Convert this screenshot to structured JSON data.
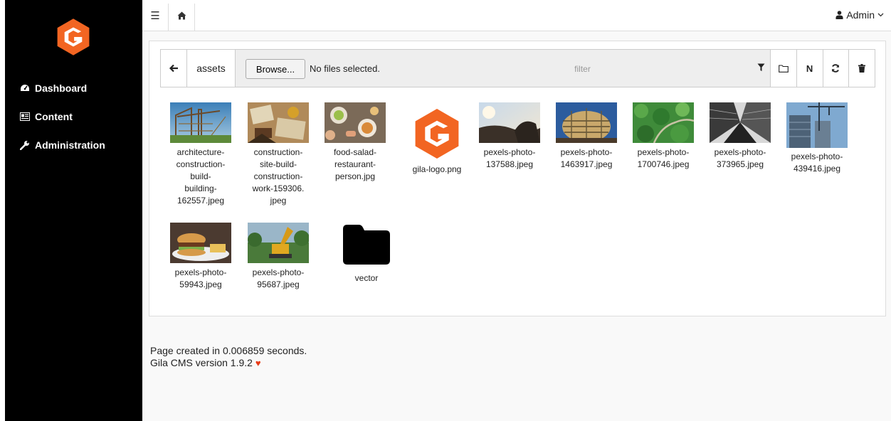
{
  "app": {
    "name": "Gila CMS"
  },
  "sidebar": {
    "items": [
      {
        "label": "Dashboard",
        "icon": "dashboard-icon"
      },
      {
        "label": "Content",
        "icon": "content-icon"
      },
      {
        "label": "Administration",
        "icon": "wrench-icon"
      }
    ]
  },
  "topbar": {
    "user": "Admin"
  },
  "filemanager": {
    "path": "assets",
    "browse_label": "Browse...",
    "no_files": "No files selected.",
    "filter_placeholder": "filter",
    "new_label": "N",
    "files": [
      {
        "name": "architecture-construction-build-building-162557.jpeg",
        "lines": [
          "architecture-",
          "construction-",
          "build-",
          "building-",
          "162557.jpeg"
        ]
      },
      {
        "name": "construction-site-build-construction-work-159306.jpeg",
        "lines": [
          "construction-",
          "site-build-",
          "construction-",
          "work-159306.",
          "jpeg"
        ]
      },
      {
        "name": "food-salad-restaurant-person.jpg",
        "lines": [
          "food-salad-",
          "restaurant-",
          "person.jpg"
        ]
      },
      {
        "name": "gila-logo.png",
        "lines": [
          "gila-logo.png"
        ]
      },
      {
        "name": "pexels-photo-137588.jpeg",
        "lines": [
          "pexels-photo-",
          "137588.jpeg"
        ]
      },
      {
        "name": "pexels-photo-1463917.jpeg",
        "lines": [
          "pexels-photo-",
          "1463917.jpeg"
        ]
      },
      {
        "name": "pexels-photo-1700746.jpeg",
        "lines": [
          "pexels-photo-",
          "1700746.jpeg"
        ]
      },
      {
        "name": "pexels-photo-373965.jpeg",
        "lines": [
          "pexels-photo-",
          "373965.jpeg"
        ]
      },
      {
        "name": "pexels-photo-439416.jpeg",
        "lines": [
          "pexels-photo-",
          "439416.jpeg"
        ]
      },
      {
        "name": "pexels-photo-59943.jpeg",
        "lines": [
          "pexels-photo-",
          "59943.jpeg"
        ]
      },
      {
        "name": "pexels-photo-95687.jpeg",
        "lines": [
          "pexels-photo-",
          "95687.jpeg"
        ]
      },
      {
        "name": "vector",
        "lines": [
          "vector"
        ]
      }
    ]
  },
  "footer": {
    "created": "Page created in 0.006859 seconds.",
    "version": "Gila CMS version 1.9.2"
  },
  "colors": {
    "brand": "#f26522",
    "sidebar": "#000000",
    "heart": "#e83a17"
  }
}
